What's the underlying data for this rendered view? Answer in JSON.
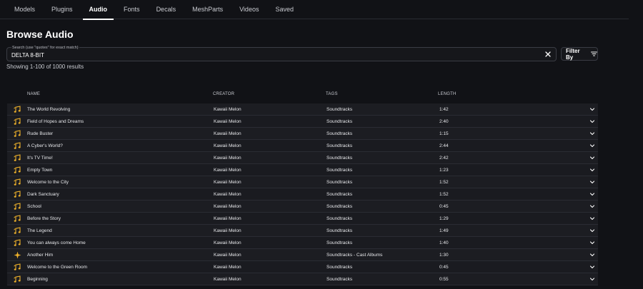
{
  "tabs": [
    {
      "label": "Models",
      "active": false
    },
    {
      "label": "Plugins",
      "active": false
    },
    {
      "label": "Audio",
      "active": true
    },
    {
      "label": "Fonts",
      "active": false
    },
    {
      "label": "Decals",
      "active": false
    },
    {
      "label": "MeshParts",
      "active": false
    },
    {
      "label": "Videos",
      "active": false
    },
    {
      "label": "Saved",
      "active": false
    }
  ],
  "page_title": "Browse Audio",
  "search": {
    "hint": "Search (use \"quotes\" for exact match)",
    "value": "DELTA 8-BIT"
  },
  "filter_label": "Filter By",
  "results_text": "Showing 1-100 of 1000 results",
  "columns": {
    "name": "NAME",
    "creator": "CREATOR",
    "tags": "TAGS",
    "length": "LENGTH"
  },
  "colors": {
    "accent_icon": "#f2b42b",
    "background": "#111216"
  },
  "rows": [
    {
      "icon": "music-notes-icon",
      "name": "The World Revolving",
      "creator": "Kawaii Melon",
      "tags": "Soundtracks",
      "length": "1:42"
    },
    {
      "icon": "music-notes-icon",
      "name": "Field of Hopes and Dreams",
      "creator": "Kawaii Melon",
      "tags": "Soundtracks",
      "length": "2:40"
    },
    {
      "icon": "music-notes-icon",
      "name": "Rude Buster",
      "creator": "Kawaii Melon",
      "tags": "Soundtracks",
      "length": "1:15"
    },
    {
      "icon": "music-notes-icon",
      "name": "A Cyber's World?",
      "creator": "Kawaii Melon",
      "tags": "Soundtracks",
      "length": "2:44"
    },
    {
      "icon": "music-notes-icon",
      "name": "It's TV Time!",
      "creator": "Kawaii Melon",
      "tags": "Soundtracks",
      "length": "2:42"
    },
    {
      "icon": "music-notes-icon",
      "name": "Empty Town",
      "creator": "Kawaii Melon",
      "tags": "Soundtracks",
      "length": "1:23"
    },
    {
      "icon": "music-notes-icon",
      "name": "Welcome to the City",
      "creator": "Kawaii Melon",
      "tags": "Soundtracks",
      "length": "1:52"
    },
    {
      "icon": "music-notes-icon",
      "name": "Dark Sanctuary",
      "creator": "Kawaii Melon",
      "tags": "Soundtracks",
      "length": "1:52"
    },
    {
      "icon": "music-notes-icon",
      "name": "School",
      "creator": "Kawaii Melon",
      "tags": "Soundtracks",
      "length": "0:45"
    },
    {
      "icon": "music-notes-icon",
      "name": "Before the Story",
      "creator": "Kawaii Melon",
      "tags": "Soundtracks",
      "length": "1:29"
    },
    {
      "icon": "music-notes-icon",
      "name": "The Legend",
      "creator": "Kawaii Melon",
      "tags": "Soundtracks",
      "length": "1:49"
    },
    {
      "icon": "music-notes-icon",
      "name": "You can always come Home",
      "creator": "Kawaii Melon",
      "tags": "Soundtracks",
      "length": "1:40"
    },
    {
      "icon": "star-burst-icon",
      "name": "Another Him",
      "creator": "Kawaii Melon",
      "tags": "Soundtracks - Cast Albums",
      "length": "1:30"
    },
    {
      "icon": "music-notes-icon",
      "name": "Welcome to the Green Room",
      "creator": "Kawaii Melon",
      "tags": "Soundtracks",
      "length": "0:45"
    },
    {
      "icon": "music-notes-icon",
      "name": "Beginning",
      "creator": "Kawaii Melon",
      "tags": "Soundtracks",
      "length": "0:55"
    }
  ]
}
